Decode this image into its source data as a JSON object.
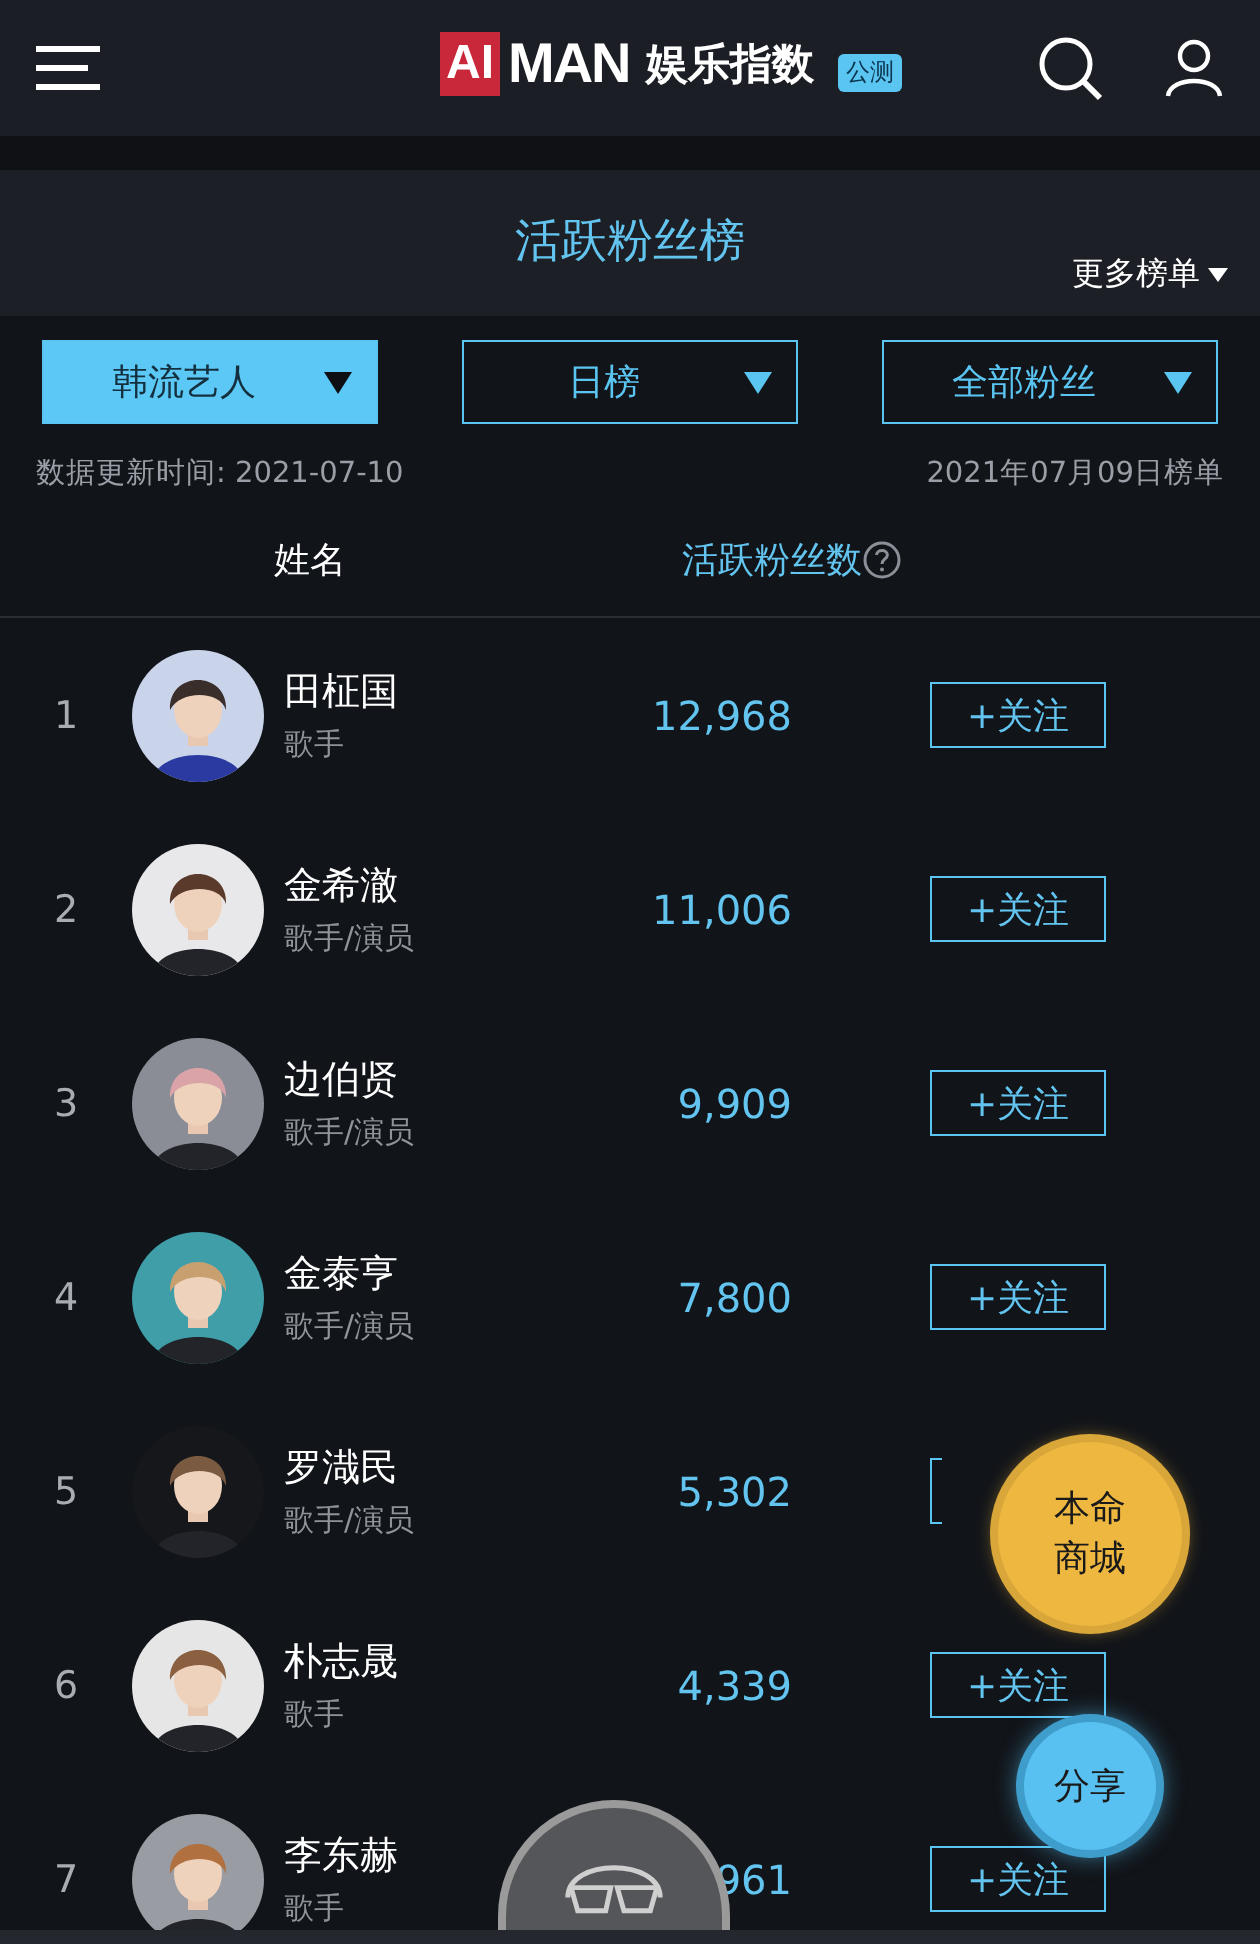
{
  "logo": {
    "mark": "AI",
    "word": "MAN",
    "name": "娱乐指数",
    "tag": "公测"
  },
  "title": "活跃粉丝榜",
  "more_link": "更多榜单",
  "filters": [
    {
      "label": "韩流艺人",
      "selected": true
    },
    {
      "label": "日榜",
      "selected": false
    },
    {
      "label": "全部粉丝",
      "selected": false
    }
  ],
  "update_time": "数据更新时间: 2021-07-10",
  "chart_date": "2021年07月09日榜单",
  "columns": [
    "姓名",
    "活跃粉丝数"
  ],
  "rows": [
    {
      "rank": "1",
      "name": "田柾国",
      "role": "歌手",
      "count": "12,968",
      "follow": "+关注"
    },
    {
      "rank": "2",
      "name": "金希澈",
      "role": "歌手/演员",
      "count": "11,006",
      "follow": "+关注"
    },
    {
      "rank": "3",
      "name": "边伯贤",
      "role": "歌手/演员",
      "count": "9,909",
      "follow": "+关注"
    },
    {
      "rank": "4",
      "name": "金泰亨",
      "role": "歌手/演员",
      "count": "7,800",
      "follow": "+关注"
    },
    {
      "rank": "5",
      "name": "罗渽民",
      "role": "歌手/演员",
      "count": "5,302"
    },
    {
      "rank": "6",
      "name": "朴志晟",
      "role": "歌手",
      "count": "4,339",
      "follow": "+关注"
    },
    {
      "rank": "7",
      "name": "李东赫",
      "role": "歌手",
      "count": "961",
      "follow": "+关注"
    }
  ],
  "fab_buttons": [
    {
      "kind": "shop",
      "label": "本命商城"
    },
    {
      "kind": "share",
      "label": "分享"
    }
  ]
}
